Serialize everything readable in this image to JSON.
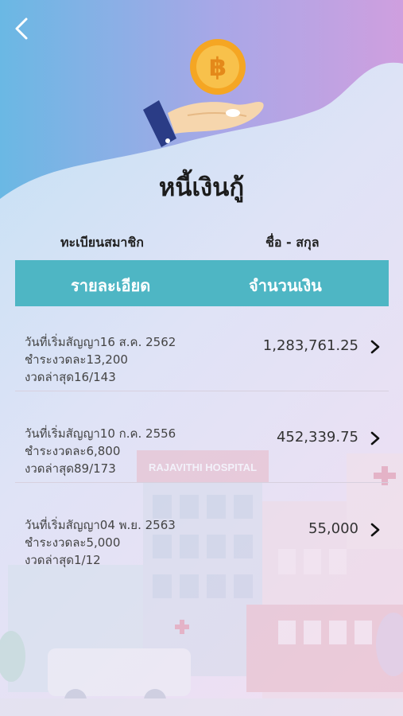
{
  "header": {
    "title": "หนี้เงินกู้",
    "member_label": "ทะเบียนสมาชิก",
    "name_label": "ชื่อ - สกุล"
  },
  "table": {
    "col_detail": "รายละเอียด",
    "col_amount": "จำนวนเงิน"
  },
  "background": {
    "hospital_sign": "RAJAVITHI HOSPITAL"
  },
  "loans": [
    {
      "start": "วันที่เริ่มสัญญา16 ส.ค. 2562",
      "installment": "ชำระงวดละ13,200",
      "latest": "งวดล่าสุด16/143",
      "amount": "1,283,761.25"
    },
    {
      "start": "วันที่เริ่มสัญญา10 ก.ค. 2556",
      "installment": "ชำระงวดละ6,800",
      "latest": "งวดล่าสุด89/173",
      "amount": "452,339.75"
    },
    {
      "start": "วันที่เริ่มสัญญา04 พ.ย. 2563",
      "installment": "ชำระงวดละ5,000",
      "latest": "งวดล่าสุด1/12",
      "amount": "55,000"
    }
  ],
  "colors": {
    "header_bar": "#4eb6c4",
    "coin": "#f5a623",
    "wave_blue": "#6ab8e4",
    "wave_purple": "#cf9fdf"
  },
  "icons": {
    "back": "chevron-left-icon",
    "coin": "baht-coin-icon",
    "hand": "open-hand-icon",
    "row_arrow": "chevron-right-icon"
  }
}
